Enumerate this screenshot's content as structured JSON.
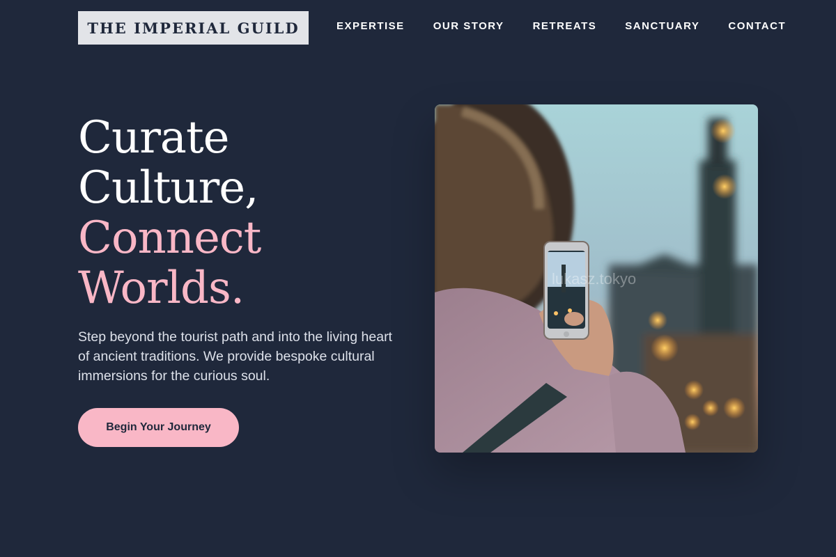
{
  "brand": {
    "name": "THE IMPERIAL GUILD"
  },
  "nav": {
    "items": [
      {
        "label": "EXPERTISE"
      },
      {
        "label": "OUR STORY"
      },
      {
        "label": "RETREATS"
      },
      {
        "label": "SANCTUARY"
      },
      {
        "label": "CONTACT"
      }
    ]
  },
  "hero": {
    "headline_line1": "Curate",
    "headline_line2": "Culture,",
    "headline_line3": "Connect",
    "headline_line4": "Worlds.",
    "description": "Step beyond the tourist path and into the living heart of ancient traditions. We provide bespoke cultural immersions for the curious soul.",
    "cta_label": "Begin Your Journey",
    "image_watermark": "lukasz.tokyo"
  },
  "colors": {
    "background": "#1f283b",
    "accent_pink": "#f9b7c6",
    "logo_bg": "#e2e4e8",
    "text_white": "#ffffff"
  },
  "icons": [
    "photo-illustration"
  ]
}
